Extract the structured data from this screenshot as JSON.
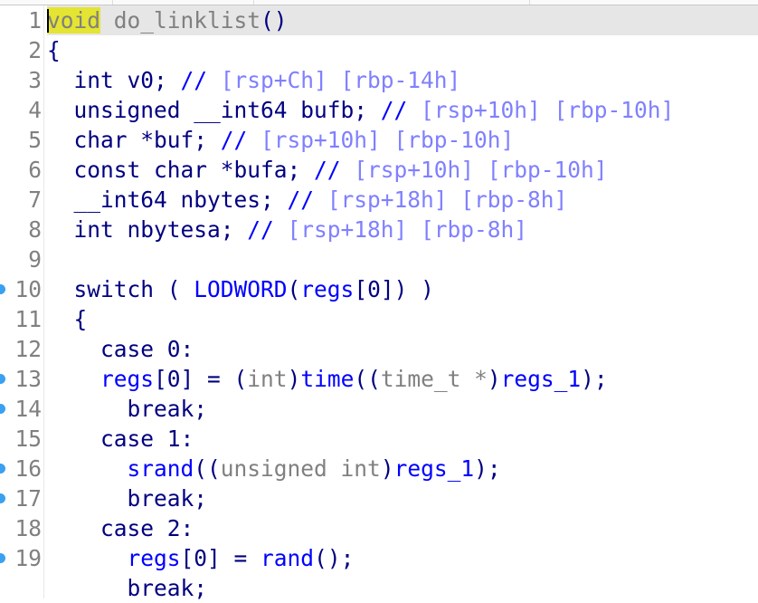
{
  "editor": {
    "view": "pseudocode",
    "current_line": 1,
    "colors": {
      "keyword": "#000080",
      "identifier": "#0000ff",
      "type": "#808080",
      "comment": "#8080ff",
      "highlight": "#e4e432",
      "breakpoint": "#3aa0f0"
    },
    "lines": [
      {
        "n": "1",
        "bp": false,
        "tokens": [
          [
            "void",
            "hl"
          ],
          [
            " do_linklist",
            "fn"
          ],
          [
            "()",
            "kw"
          ]
        ]
      },
      {
        "n": "2",
        "bp": false,
        "tokens": [
          [
            "{",
            "kw"
          ]
        ]
      },
      {
        "n": "3",
        "bp": false,
        "tokens": [
          [
            "  int v0; ",
            "kw"
          ],
          [
            "// ",
            "sl"
          ],
          [
            "[rsp+Ch] [rbp-14h]",
            "cm"
          ]
        ]
      },
      {
        "n": "4",
        "bp": false,
        "tokens": [
          [
            "  unsigned __int64 bufb; ",
            "kw"
          ],
          [
            "// ",
            "sl"
          ],
          [
            "[rsp+10h] [rbp-10h]",
            "cm"
          ]
        ]
      },
      {
        "n": "5",
        "bp": false,
        "tokens": [
          [
            "  char *buf; ",
            "kw"
          ],
          [
            "// ",
            "sl"
          ],
          [
            "[rsp+10h] [rbp-10h]",
            "cm"
          ]
        ]
      },
      {
        "n": "6",
        "bp": false,
        "tokens": [
          [
            "  const char *bufa; ",
            "kw"
          ],
          [
            "// ",
            "sl"
          ],
          [
            "[rsp+10h] [rbp-10h]",
            "cm"
          ]
        ]
      },
      {
        "n": "7",
        "bp": false,
        "tokens": [
          [
            "  __int64 nbytes; ",
            "kw"
          ],
          [
            "// ",
            "sl"
          ],
          [
            "[rsp+18h] [rbp-8h]",
            "cm"
          ]
        ]
      },
      {
        "n": "8",
        "bp": false,
        "tokens": [
          [
            "  int nbytesa; ",
            "kw"
          ],
          [
            "// ",
            "sl"
          ],
          [
            "[rsp+18h] [rbp-8h]",
            "cm"
          ]
        ]
      },
      {
        "n": "9",
        "bp": false,
        "tokens": []
      },
      {
        "n": "10",
        "bp": true,
        "tokens": [
          [
            "  switch ( ",
            "kw"
          ],
          [
            "LODWORD",
            "id"
          ],
          [
            "(",
            "kw"
          ],
          [
            "regs",
            "id"
          ],
          [
            "[0]) )",
            "kw"
          ]
        ]
      },
      {
        "n": "11",
        "bp": false,
        "tokens": [
          [
            "  {",
            "kw"
          ]
        ]
      },
      {
        "n": "12",
        "bp": false,
        "tokens": [
          [
            "    case 0:",
            "kw"
          ]
        ]
      },
      {
        "n": "13",
        "bp": true,
        "tokens": [
          [
            "    ",
            "kw"
          ],
          [
            "regs",
            "id"
          ],
          [
            "[0] = (",
            "kw"
          ],
          [
            "int",
            "ty"
          ],
          [
            ")",
            "kw"
          ],
          [
            "time",
            "id"
          ],
          [
            "((",
            "kw"
          ],
          [
            "time_t *",
            "ty"
          ],
          [
            ")",
            "kw"
          ],
          [
            "regs_1",
            "id"
          ],
          [
            ");",
            "kw"
          ]
        ]
      },
      {
        "n": "14",
        "bp": true,
        "tokens": [
          [
            "      break;",
            "kw"
          ]
        ]
      },
      {
        "n": "15",
        "bp": false,
        "tokens": [
          [
            "    case 1:",
            "kw"
          ]
        ]
      },
      {
        "n": "16",
        "bp": true,
        "tokens": [
          [
            "      ",
            "kw"
          ],
          [
            "srand",
            "id"
          ],
          [
            "((",
            "kw"
          ],
          [
            "unsigned int",
            "ty"
          ],
          [
            ")",
            "kw"
          ],
          [
            "regs_1",
            "id"
          ],
          [
            ");",
            "kw"
          ]
        ]
      },
      {
        "n": "17",
        "bp": true,
        "tokens": [
          [
            "      break;",
            "kw"
          ]
        ]
      },
      {
        "n": "18",
        "bp": false,
        "tokens": [
          [
            "    case 2:",
            "kw"
          ]
        ]
      },
      {
        "n": "19",
        "bp": true,
        "tokens": [
          [
            "      ",
            "kw"
          ],
          [
            "regs",
            "id"
          ],
          [
            "[0] = ",
            "kw"
          ],
          [
            "rand",
            "id"
          ],
          [
            "();",
            "kw"
          ]
        ]
      },
      {
        "n": "",
        "bp": false,
        "tokens": [
          [
            "      break;",
            "kw"
          ]
        ]
      }
    ]
  }
}
